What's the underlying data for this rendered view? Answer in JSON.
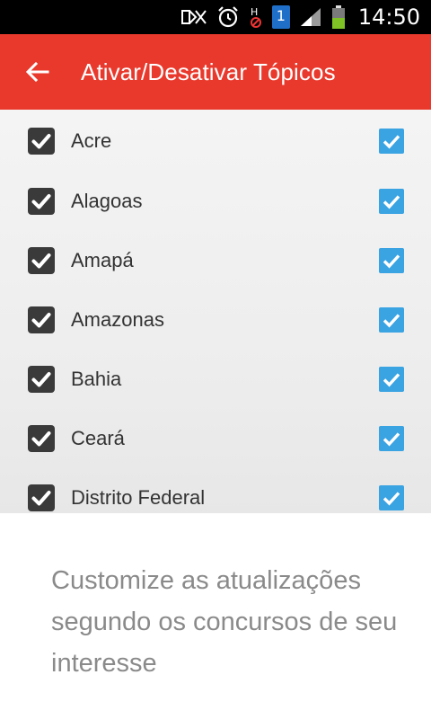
{
  "status_bar": {
    "time": "14:50",
    "sim_number": "1",
    "icons": [
      "mute-icon",
      "alarm-icon",
      "hd-disabled-icon",
      "sim-icon",
      "signal-icon",
      "battery-icon"
    ]
  },
  "toolbar": {
    "title": "Ativar/Desativar Tópicos",
    "back_icon": "arrow-left-icon",
    "color": "#e8392c"
  },
  "topics": [
    {
      "label": "Acre",
      "checked": true
    },
    {
      "label": "Alagoas",
      "checked": true
    },
    {
      "label": "Amapá",
      "checked": true
    },
    {
      "label": "Amazonas",
      "checked": true
    },
    {
      "label": "Bahia",
      "checked": true
    },
    {
      "label": "Ceará",
      "checked": true
    },
    {
      "label": "Distrito Federal",
      "checked": true
    }
  ],
  "checkbox_colors": {
    "left": "#3a3a3a",
    "right": "#3aa3e2"
  },
  "info_panel": {
    "text": "Customize as atualizações segundo os concursos de seu interesse"
  }
}
